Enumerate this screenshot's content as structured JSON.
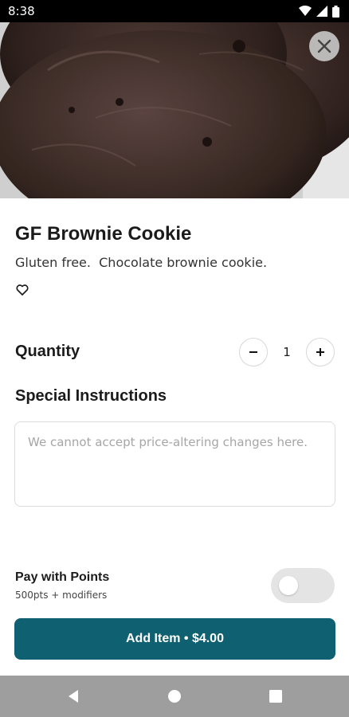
{
  "status_bar": {
    "time": "8:38",
    "icons": [
      "wifi-icon",
      "cellular-signal-icon",
      "battery-icon"
    ]
  },
  "hero": {
    "image_alt": "brownie cookie photo",
    "close_icon": "close-icon"
  },
  "item": {
    "title": "GF Brownie Cookie",
    "description": "Gluten free.  Chocolate brownie cookie.",
    "favorite_icon": "heart-outline-icon"
  },
  "quantity": {
    "label": "Quantity",
    "value": "1",
    "minus_icon": "minus-icon",
    "plus_icon": "plus-icon"
  },
  "special_instructions": {
    "label": "Special Instructions",
    "value": "",
    "placeholder": "We cannot accept price-altering changes here."
  },
  "points": {
    "label": "Pay with Points",
    "sublabel": "500pts + modifiers",
    "enabled": false
  },
  "add_button": {
    "label": "Add Item • $4.00"
  },
  "nav_bar": {
    "icons": [
      "back-icon",
      "home-icon",
      "recents-icon"
    ]
  },
  "colors": {
    "accent": "#0f6070",
    "nav_bar": "#9e9e9e",
    "toggle_off": "#e4e4e4"
  }
}
